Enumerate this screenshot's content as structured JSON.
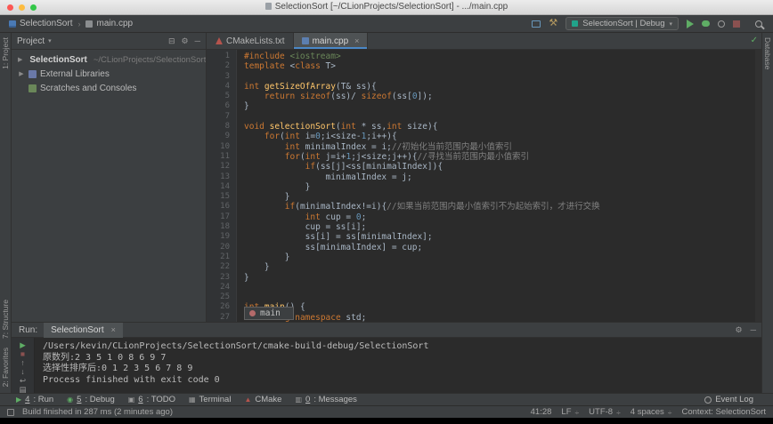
{
  "title_bar": {
    "title": "SelectionSort [~/CLionProjects/SelectionSort] - .../main.cpp"
  },
  "nav_bar": {
    "items": [
      {
        "label": "SelectionSort",
        "icon": "project"
      },
      {
        "label": "main.cpp",
        "icon": "file"
      }
    ]
  },
  "toolbar": {
    "run_config_label": "SelectionSort | Debug"
  },
  "icons": {
    "chevron": "›",
    "caret": "▾",
    "close": "×",
    "gear": "⚙",
    "hammer": "⚒",
    "minus": "─",
    "collapse": "⊟",
    "check": "✓",
    "divide": "÷"
  },
  "project_panel": {
    "header_label": "Project",
    "tree": [
      {
        "label": "SelectionSort",
        "suffix": "~/CLionProjects/SelectionSort",
        "arrow": true,
        "icon": "folder"
      },
      {
        "label": "External Libraries",
        "suffix": "",
        "arrow": true,
        "icon": "libraries"
      },
      {
        "label": "Scratches and Consoles",
        "suffix": "",
        "arrow": false,
        "icon": "scratches"
      }
    ]
  },
  "editor": {
    "tabs": [
      {
        "label": "CMakeLists.txt",
        "active": false,
        "icon": "cmake"
      },
      {
        "label": "main.cpp",
        "active": true,
        "icon": "cpp"
      }
    ],
    "popup_label": "main",
    "code": [
      [
        [
          "k",
          "#include "
        ],
        [
          "s",
          "<iostream>"
        ]
      ],
      [
        [
          "k",
          "template "
        ],
        [
          "p",
          "<"
        ],
        [
          "k",
          "class "
        ],
        [
          "p",
          "T>"
        ]
      ],
      [],
      [
        [
          "k",
          "int "
        ],
        [
          "f",
          "getSizeOfArray"
        ],
        [
          "p",
          "(T& ss){"
        ]
      ],
      [
        [
          "p",
          "    "
        ],
        [
          "k",
          "return "
        ],
        [
          "k",
          "sizeof"
        ],
        [
          "p",
          "(ss)/ "
        ],
        [
          "k",
          "sizeof"
        ],
        [
          "p",
          "(ss["
        ],
        [
          "n",
          "0"
        ],
        [
          "p",
          "]);"
        ]
      ],
      [
        [
          "p",
          "}"
        ]
      ],
      [],
      [
        [
          "k",
          "void "
        ],
        [
          "f",
          "selectionSort"
        ],
        [
          "p",
          "("
        ],
        [
          "k",
          "int "
        ],
        [
          "p",
          "* ss,"
        ],
        [
          "k",
          "int "
        ],
        [
          "p",
          "size){"
        ]
      ],
      [
        [
          "p",
          "    "
        ],
        [
          "k",
          "for"
        ],
        [
          "p",
          "("
        ],
        [
          "k",
          "int "
        ],
        [
          "p",
          "i="
        ],
        [
          "n",
          "0"
        ],
        [
          "p",
          ";i<size-"
        ],
        [
          "n",
          "1"
        ],
        [
          "p",
          ";i++){"
        ]
      ],
      [
        [
          "p",
          "        "
        ],
        [
          "k",
          "int "
        ],
        [
          "p",
          "minimalIndex = i;"
        ],
        [
          "c",
          "//初始化当前范围内最小值索引"
        ]
      ],
      [
        [
          "p",
          "        "
        ],
        [
          "k",
          "for"
        ],
        [
          "p",
          "("
        ],
        [
          "k",
          "int "
        ],
        [
          "p",
          "j=i+"
        ],
        [
          "n",
          "1"
        ],
        [
          "p",
          ";j<size;j++){"
        ],
        [
          "c",
          "//寻找当前范围内最小值索引"
        ]
      ],
      [
        [
          "p",
          "            "
        ],
        [
          "k",
          "if"
        ],
        [
          "p",
          "(ss[j]<ss[minimalIndex]){"
        ]
      ],
      [
        [
          "p",
          "                minimalIndex = j;"
        ]
      ],
      [
        [
          "p",
          "            }"
        ]
      ],
      [
        [
          "p",
          "        }"
        ]
      ],
      [
        [
          "p",
          "        "
        ],
        [
          "k",
          "if"
        ],
        [
          "p",
          "(minimalIndex!=i){"
        ],
        [
          "c",
          "//如果当前范围内最小值索引不为起始索引，才进行交换"
        ]
      ],
      [
        [
          "p",
          "            "
        ],
        [
          "k",
          "int "
        ],
        [
          "p",
          "cup = "
        ],
        [
          "n",
          "0"
        ],
        [
          "p",
          ";"
        ]
      ],
      [
        [
          "p",
          "            cup = ss[i];"
        ]
      ],
      [
        [
          "p",
          "            ss[i] = ss[minimalIndex];"
        ]
      ],
      [
        [
          "p",
          "            ss[minimalIndex] = cup;"
        ]
      ],
      [
        [
          "p",
          "        }"
        ]
      ],
      [
        [
          "p",
          "    }"
        ]
      ],
      [
        [
          "p",
          "}"
        ]
      ],
      [],
      [],
      [
        [
          "k",
          "int "
        ],
        [
          "f",
          "main"
        ],
        [
          "p",
          "() {"
        ]
      ],
      [
        [
          "p",
          "    "
        ],
        [
          "k",
          "using "
        ],
        [
          "k",
          "namespace "
        ],
        [
          "p",
          "std;"
        ]
      ]
    ]
  },
  "run_panel": {
    "label": "Run:",
    "tab_label": "SelectionSort",
    "icons": [
      {
        "name": "rerun-icon",
        "glyph": "▶",
        "color": "#5fad65"
      },
      {
        "name": "stop-icon",
        "glyph": "■",
        "color": "#8a5150"
      },
      {
        "name": "up-stack-trace-icon",
        "glyph": "↑",
        "color": "#9a9a9a"
      },
      {
        "name": "down-stack-trace-icon",
        "glyph": "↓",
        "color": "#9a9a9a"
      },
      {
        "name": "soft-wrap-icon",
        "glyph": "↩",
        "color": "#9a9a9a"
      },
      {
        "name": "clear-all-icon",
        "glyph": "▤",
        "color": "#9a9a9a"
      }
    ],
    "console_lines": [
      "/Users/kevin/CLionProjects/SelectionSort/cmake-build-debug/SelectionSort",
      "原数列:2 3 5 1 0 8 6 9 7",
      "选择性排序后:0 1 2 3 5 6 7 8 9",
      "Process finished with exit code 0"
    ]
  },
  "tool_buttons": {
    "bottom": [
      {
        "mnemonic": "4",
        "rest": ": Run",
        "glyph": "▶",
        "color": "#5fad65",
        "icon_name": "run-icon"
      },
      {
        "mnemonic": "5",
        "rest": ": Debug",
        "glyph": "◉",
        "color": "#5fad65",
        "icon_name": "debug-icon"
      },
      {
        "mnemonic": "6",
        "rest": ": TODO",
        "glyph": "▣",
        "color": "#9a9a9a",
        "icon_name": "todo-icon"
      },
      {
        "mnemonic": "",
        "rest": "Terminal",
        "glyph": "▦",
        "color": "#9a9a9a",
        "icon_name": "terminal-icon"
      },
      {
        "mnemonic": "",
        "rest": "CMake",
        "glyph": "▲",
        "color": "#b5544d",
        "icon_name": "cmake-icon"
      },
      {
        "mnemonic": "0",
        "rest": ": Messages",
        "glyph": "▥",
        "color": "#9a9a9a",
        "icon_name": "messages-icon"
      }
    ],
    "event_log": "Event Log",
    "left_top": [
      "1: Project"
    ],
    "left_bottom": [
      "7: Structure",
      "2: Favorites"
    ],
    "right": [
      "Database"
    ]
  },
  "status_bar": {
    "message": "Build finished in 287 ms (2 minutes ago)",
    "segments": [
      "41:28",
      "LF",
      "UTF-8",
      "4 spaces",
      "Context: SelectionSort"
    ]
  }
}
